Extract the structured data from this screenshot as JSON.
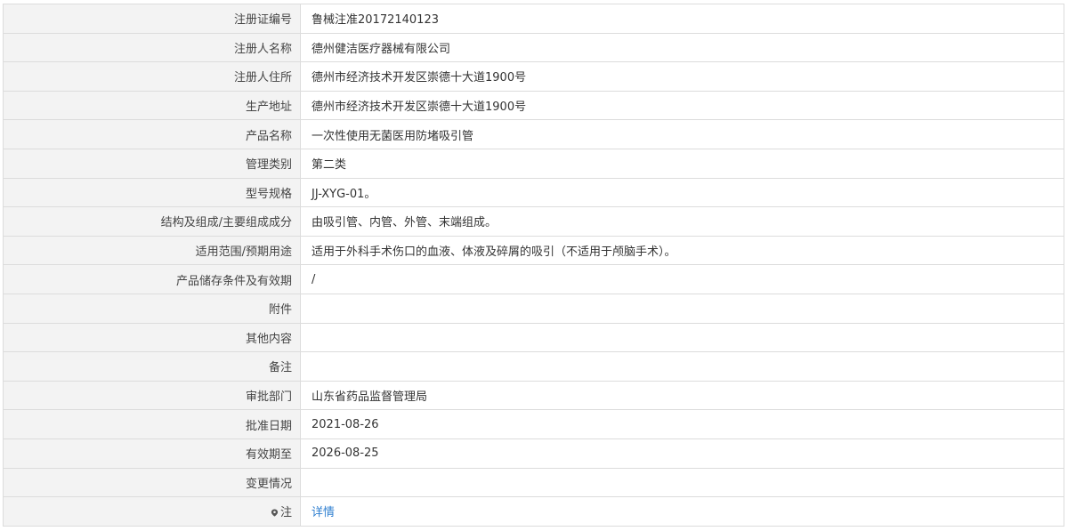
{
  "rows": [
    {
      "label": "注册证编号",
      "value": "鲁械注准20172140123"
    },
    {
      "label": "注册人名称",
      "value": "德州健洁医疗器械有限公司"
    },
    {
      "label": "注册人住所",
      "value": "德州市经济技术开发区崇德十大道1900号"
    },
    {
      "label": "生产地址",
      "value": "德州市经济技术开发区崇德十大道1900号"
    },
    {
      "label": "产品名称",
      "value": "一次性使用无菌医用防堵吸引管"
    },
    {
      "label": "管理类别",
      "value": "第二类"
    },
    {
      "label": "型号规格",
      "value": "JJ-XYG-01。"
    },
    {
      "label": "结构及组成/主要组成成分",
      "value": "由吸引管、内管、外管、末端组成。"
    },
    {
      "label": "适用范围/预期用途",
      "value": "适用于外科手术伤口的血液、体液及碎屑的吸引（不适用于颅脑手术）。"
    },
    {
      "label": "产品储存条件及有效期",
      "value": "/"
    },
    {
      "label": "附件",
      "value": ""
    },
    {
      "label": "其他内容",
      "value": ""
    },
    {
      "label": "备注",
      "value": ""
    },
    {
      "label": "审批部门",
      "value": "山东省药品监督管理局"
    },
    {
      "label": "批准日期",
      "value": "2021-08-26"
    },
    {
      "label": "有效期至",
      "value": "2026-08-25"
    },
    {
      "label": "变更情况",
      "value": ""
    }
  ],
  "note": {
    "label": "注",
    "icon": "pin-icon",
    "link_text": "详情",
    "link_color": "#2f7fd0"
  },
  "colors": {
    "label_background": "#f3f3f3",
    "border": "#dcdcdc",
    "text": "#333333"
  }
}
